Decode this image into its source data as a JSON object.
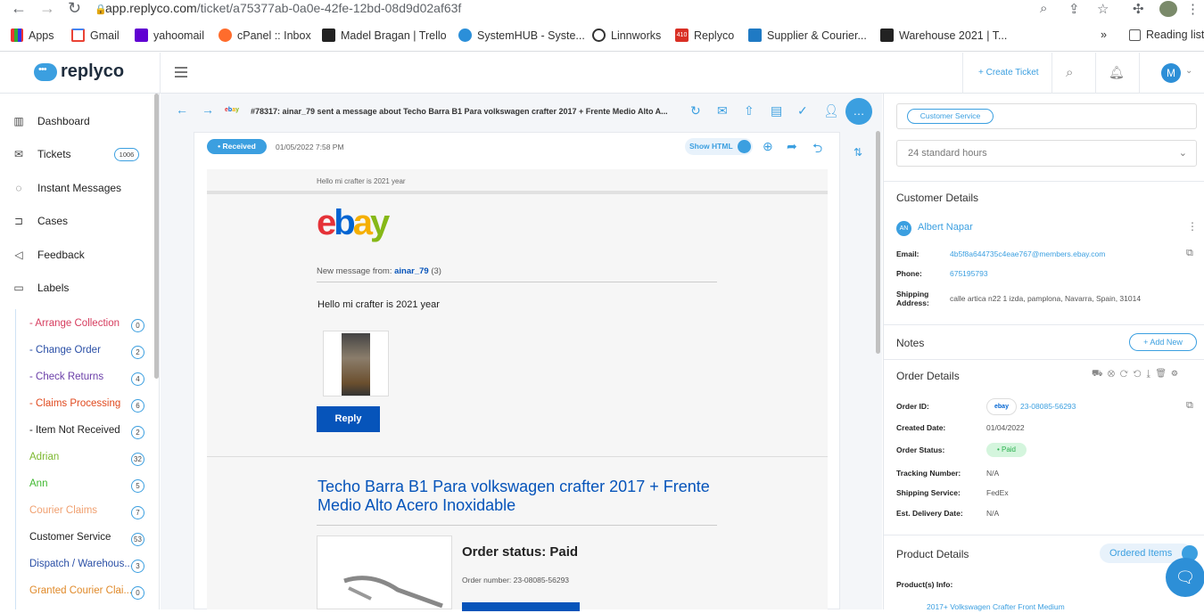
{
  "browser": {
    "url_host": "app.replyco.com",
    "url_path": "/ticket/a75377ab-0a0e-42fe-12bd-08d9d02af63f",
    "bookmarks": [
      "Apps",
      "Gmail",
      "yahoomail",
      "cPanel :: Inbox",
      "Madel Bragan | Trello",
      "SystemHUB - Syste...",
      "Linnworks",
      "Replyco",
      "Supplier & Courier...",
      "Warehouse 2021 | T..."
    ],
    "reading_list": "Reading list",
    "more": "»"
  },
  "app": {
    "logo": "replyco",
    "create_ticket": "+ Create Ticket",
    "avatar_initial": "M"
  },
  "sidebar": {
    "nav": [
      {
        "label": "Dashboard",
        "icon": "bar-chart-icon"
      },
      {
        "label": "Tickets",
        "icon": "mail-icon"
      },
      {
        "label": "Instant Messages",
        "icon": "chat-icon"
      },
      {
        "label": "Cases",
        "icon": "case-icon"
      },
      {
        "label": "Feedback",
        "icon": "megaphone-icon"
      },
      {
        "label": "Labels",
        "icon": "folder-icon"
      }
    ],
    "ticket_count": "1006",
    "labels": [
      {
        "label": "- Arrange Collection",
        "count": "0",
        "color": "#d63c5e"
      },
      {
        "label": "- Change Order",
        "count": "2",
        "color": "#2a4fa6"
      },
      {
        "label": "- Check Returns",
        "count": "4",
        "color": "#6a3ea8"
      },
      {
        "label": "- Claims Processing",
        "count": "6",
        "color": "#e04a1f"
      },
      {
        "label": "- Item Not Received",
        "count": "2",
        "color": "#222222"
      },
      {
        "label": "Adrian",
        "count": "32",
        "color": "#7cb82f"
      },
      {
        "label": "Ann",
        "count": "5",
        "color": "#3fb82f"
      },
      {
        "label": "Courier Claims",
        "count": "7",
        "color": "#f0a070"
      },
      {
        "label": "Customer Service",
        "count": "53",
        "color": "#222222"
      },
      {
        "label": "Dispatch / Warehous...",
        "count": "3",
        "color": "#2a4fa6"
      },
      {
        "label": "Granted Courier Clai...",
        "count": "0",
        "color": "#e08a2a"
      }
    ]
  },
  "ticket": {
    "subject": "#78317: ainar_79 sent a message about Techo Barra B1 Para volkswagen crafter 2017 + Frente Medio Alto A...",
    "status": "• Received",
    "date": "01/05/2022 7:58 PM",
    "show_html": "Show HTML"
  },
  "email": {
    "preheader": "Hello mi crafter is 2021 year",
    "logo_letters": [
      {
        "ch": "e",
        "color": "#e53238"
      },
      {
        "ch": "b",
        "color": "#0064d2"
      },
      {
        "ch": "a",
        "color": "#f5af02"
      },
      {
        "ch": "y",
        "color": "#86b817"
      }
    ],
    "new_message_prefix": "New message from: ",
    "sender": "ainar_79",
    "sender_count": " (3)",
    "body": "Hello mi crafter is 2021 year",
    "reply_label": "Reply",
    "product_title": "Techo Barra B1 Para volkswagen crafter 2017 + Frente Medio Alto Acero Inoxidable",
    "order_status": "Order status: Paid",
    "order_number": "Order number: 23-08085-56293"
  },
  "right": {
    "tag": "Customer Service",
    "sla": "24 standard hours",
    "customer_details_title": "Customer Details",
    "initials": "AN",
    "name": "Albert Napar",
    "email_label": "Email:",
    "email": "4b5f8a644735c4eae767@members.ebay.com",
    "phone_label": "Phone:",
    "phone": "675195793",
    "shipping_label_1": "Shipping",
    "shipping_label_2": "Address:",
    "address": "calle artica n22 1 izda, pamplona, Navarra, Spain, 31014",
    "notes_title": "Notes",
    "add_new": "+ Add New",
    "order_details_title": "Order Details",
    "order_id_label": "Order ID:",
    "order_pill": "ebay",
    "order_id": "23-08085-56293",
    "created_label": "Created Date:",
    "created": "01/04/2022",
    "order_status_label": "Order Status:",
    "order_status": "• Paid",
    "tracking_label": "Tracking Number:",
    "tracking": "N/A",
    "shipping_service_label": "Shipping Service:",
    "shipping_service": "FedEx",
    "delivery_label": "Est. Delivery Date:",
    "delivery": "N/A",
    "product_details_title": "Product Details",
    "ordered_items": "Ordered Items",
    "products_info_label": "Product(s) Info:",
    "product_link": "2017+ Volkswagen Crafter Front Medium"
  }
}
